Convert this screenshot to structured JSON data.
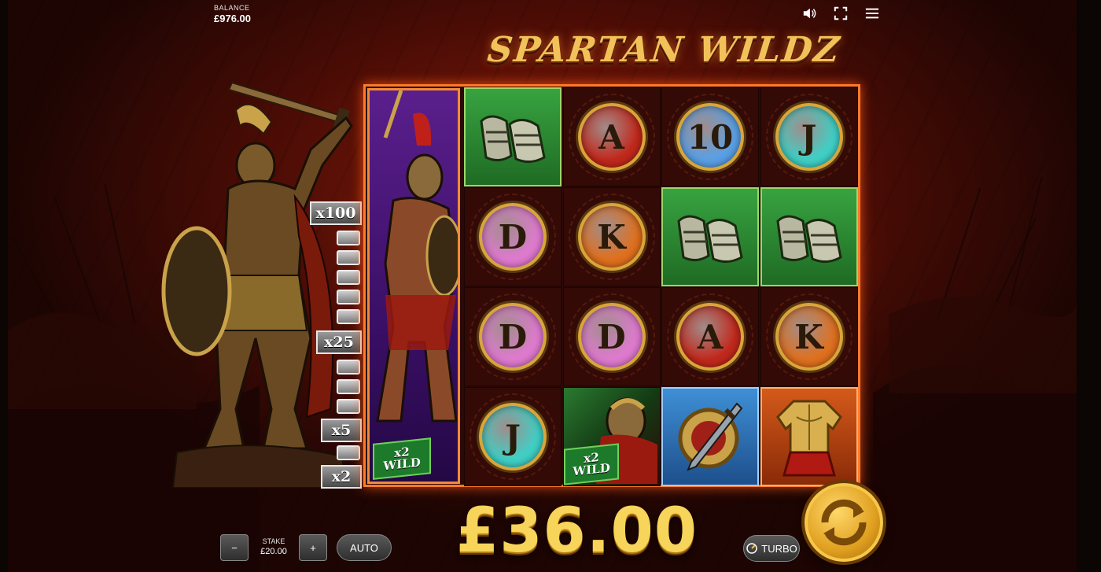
{
  "header": {
    "balance_label": "BALANCE",
    "balance_value": "£976.00",
    "icons": [
      "speaker-icon",
      "fullscreen-icon",
      "menu-icon"
    ]
  },
  "logo_text": "SPARTAN WILDZ",
  "ladder": {
    "multipliers": [
      "x100",
      "x25",
      "x5",
      "x2"
    ]
  },
  "big_wild": {
    "line1": "x2",
    "line2": "WILD"
  },
  "grid": {
    "rows": [
      [
        "sandals",
        "A",
        "10",
        "J"
      ],
      [
        "D",
        "K",
        "sandals",
        "sandals"
      ],
      [
        "D",
        "D",
        "A",
        "K"
      ],
      [
        "J",
        "warrior-wild",
        "shield-sword",
        "armor"
      ]
    ],
    "cell_wild": {
      "line1": "x2",
      "line2": "WILD"
    }
  },
  "win_amount": "£36.00",
  "controls": {
    "minus_label": "−",
    "plus_label": "+",
    "stake_label": "STAKE",
    "stake_value": "£20.00",
    "auto_label": "AUTO",
    "turbo_label": "TURBO"
  },
  "colors": {
    "frame": "#ff7a2a",
    "win_gold": "#f7d45a",
    "spin_gold": "#e0a020"
  }
}
